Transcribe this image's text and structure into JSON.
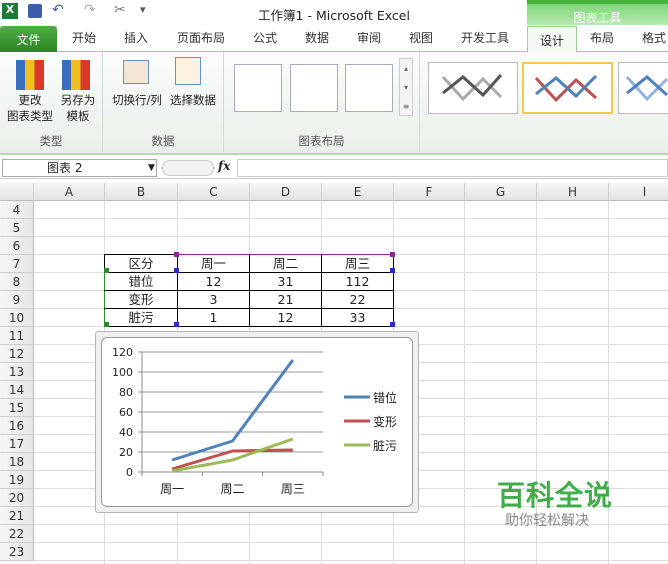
{
  "titlebar": {
    "title": "工作簿1  -  Microsoft Excel",
    "context_tab": "图表工具"
  },
  "tabs": [
    "文件",
    "开始",
    "插入",
    "页面布局",
    "公式",
    "数据",
    "审阅",
    "视图",
    "开发工具",
    "设计",
    "布局",
    "格式"
  ],
  "ribbon": {
    "change_type": [
      "更改",
      "图表类型"
    ],
    "save_template": [
      "另存为",
      "模板"
    ],
    "switch_row_col": "切换行/列",
    "select_data": "选择数据",
    "groups": [
      "类型",
      "数据",
      "图表布局"
    ]
  },
  "formula_bar": {
    "name_box": "图表 2",
    "fx": "fx"
  },
  "columns": [
    "A",
    "B",
    "C",
    "D",
    "E",
    "F",
    "G",
    "H",
    "I"
  ],
  "rows": [
    "4",
    "5",
    "6",
    "7",
    "8",
    "9",
    "10",
    "11",
    "12",
    "13",
    "14",
    "15",
    "16",
    "17",
    "18",
    "19",
    "20",
    "21",
    "22",
    "23"
  ],
  "table": {
    "header": [
      "区分",
      "周一",
      "周二",
      "周三"
    ],
    "rows": [
      [
        "错位",
        "12",
        "31",
        "112"
      ],
      [
        "变形",
        "3",
        "21",
        "22"
      ],
      [
        "脏污",
        "1",
        "12",
        "33"
      ]
    ]
  },
  "chart_data": {
    "type": "line",
    "categories": [
      "周一",
      "周二",
      "周三"
    ],
    "series": [
      {
        "name": "错位",
        "values": [
          12,
          31,
          112
        ],
        "color": "#4f81bd"
      },
      {
        "name": "变形",
        "values": [
          3,
          21,
          22
        ],
        "color": "#c0504d"
      },
      {
        "name": "脏污",
        "values": [
          1,
          12,
          33
        ],
        "color": "#9bbb59"
      }
    ],
    "ylim": [
      0,
      120
    ],
    "yticks": [
      "0",
      "20",
      "40",
      "60",
      "80",
      "100",
      "120"
    ],
    "legend": "right",
    "grid": true
  },
  "watermark": {
    "title": "百科全说",
    "subtitle": "助你轻松解决"
  }
}
